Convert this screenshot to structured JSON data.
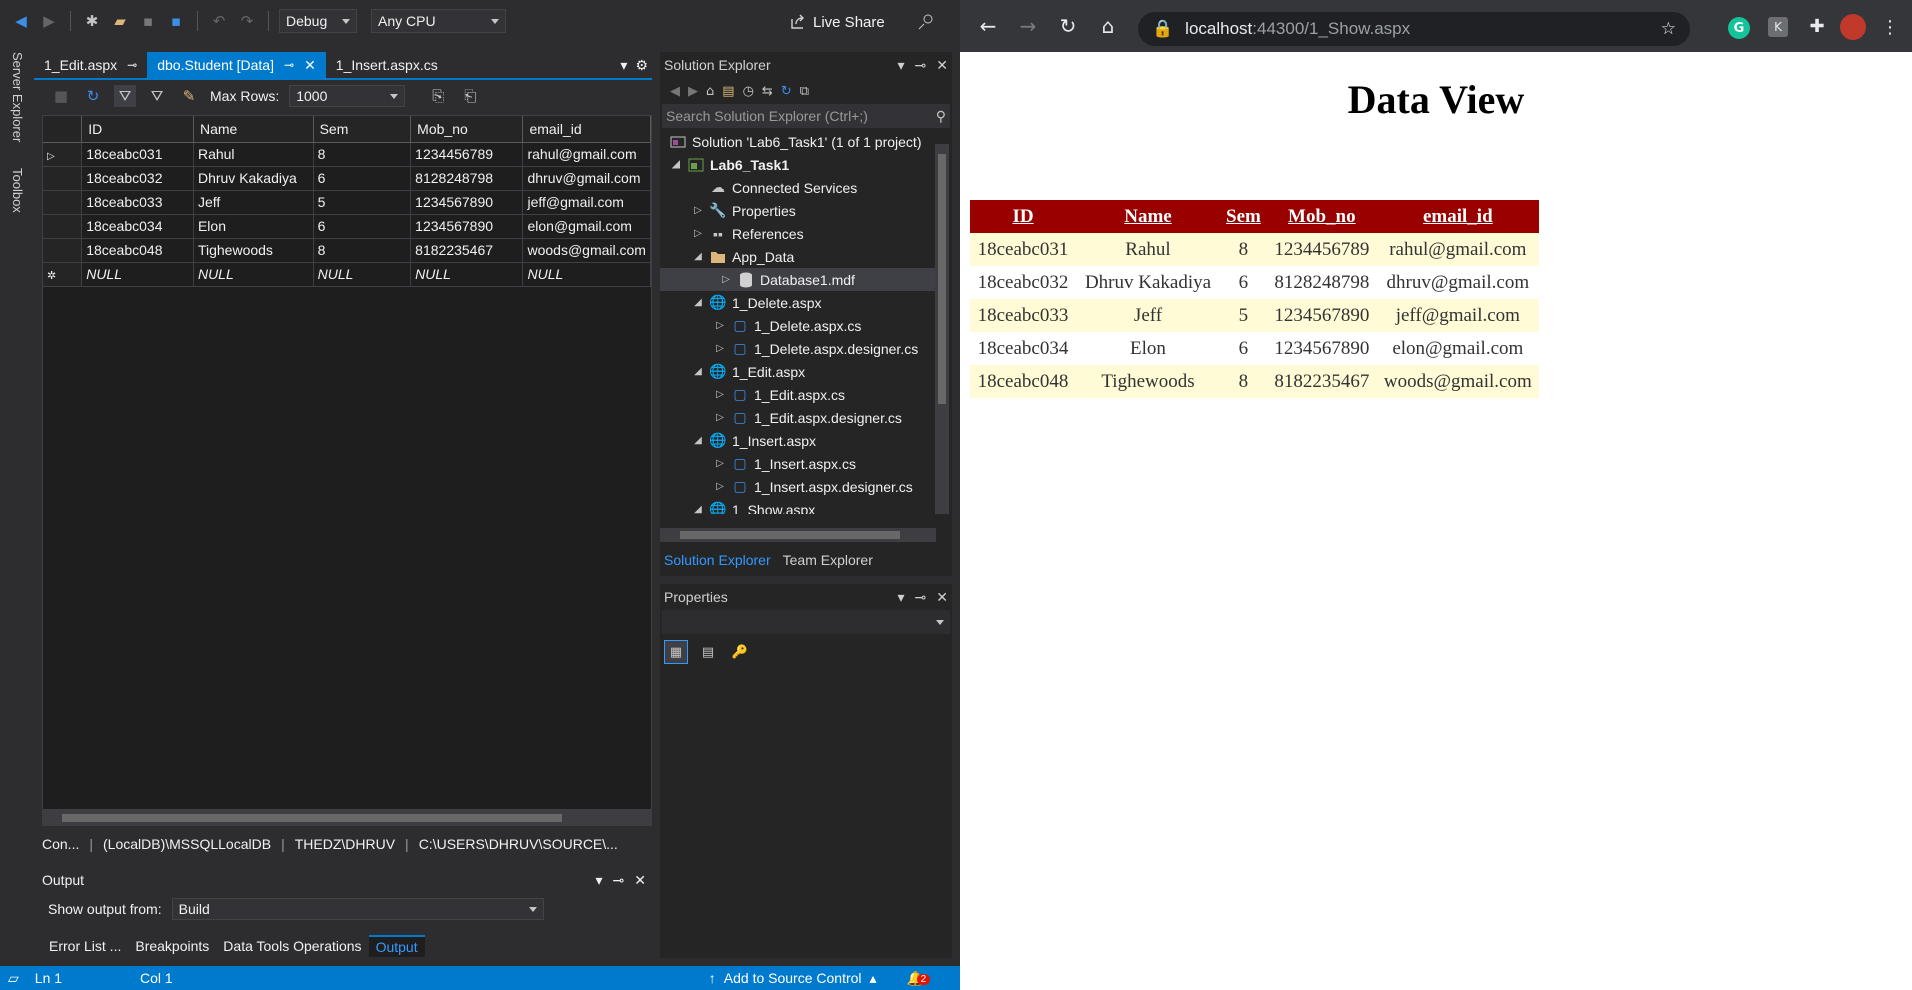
{
  "vs": {
    "toolbar": {
      "config": "Debug",
      "platform": "Any CPU",
      "live_share": "Live Share"
    },
    "side_rail": {
      "server_explorer": "Server Explorer",
      "toolbox": "Toolbox"
    },
    "doc_tabs": [
      "1_Edit.aspx",
      "dbo.Student [Data]",
      "1_Insert.aspx.cs"
    ],
    "data_toolbar": {
      "max_rows_label": "Max Rows:",
      "max_rows_value": "1000"
    },
    "grid": {
      "columns": [
        "ID",
        "Name",
        "Sem",
        "Mob_no",
        "email_id"
      ],
      "rows": [
        [
          "18ceabc031",
          "Rahul",
          "8",
          "1234456789",
          "rahul@gmail.com"
        ],
        [
          "18ceabc032",
          "Dhruv Kakadiya",
          "6",
          "8128248798",
          "dhruv@gmail.com"
        ],
        [
          "18ceabc033",
          "Jeff",
          "5",
          "1234567890",
          "jeff@gmail.com"
        ],
        [
          "18ceabc034",
          "Elon",
          "6",
          "1234567890",
          "elon@gmail.com"
        ],
        [
          "18ceabc048",
          "Tighewoods",
          "8",
          "8182235467",
          "woods@gmail.com"
        ]
      ],
      "null_row": [
        "NULL",
        "NULL",
        "NULL",
        "NULL",
        "NULL"
      ]
    },
    "connection": {
      "label": "Con...",
      "server": "(LocalDB)\\MSSQLLocalDB",
      "user": "THEDZ\\DHRUV",
      "path": "C:\\USERS\\DHRUV\\SOURCE\\..."
    },
    "output": {
      "title": "Output",
      "show_from_label": "Show output from:",
      "show_from_value": "Build"
    },
    "bottom_tabs": [
      "Error List ...",
      "Breakpoints",
      "Data Tools Operations",
      "Output"
    ],
    "status": {
      "line": "Ln 1",
      "col": "Col 1",
      "source_control": "Add to Source Control",
      "notifications": "2"
    },
    "solution_explorer": {
      "title": "Solution Explorer",
      "search_placeholder": "Search Solution Explorer (Ctrl+;)",
      "items": [
        "Solution 'Lab6_Task1' (1 of 1 project)",
        "Lab6_Task1",
        "Connected Services",
        "Properties",
        "References",
        "App_Data",
        "Database1.mdf",
        "1_Delete.aspx",
        "1_Delete.aspx.cs",
        "1_Delete.aspx.designer.cs",
        "1_Edit.aspx",
        "1_Edit.aspx.cs",
        "1_Edit.aspx.designer.cs",
        "1_Insert.aspx",
        "1_Insert.aspx.cs",
        "1_Insert.aspx.designer.cs",
        "1_Show.aspx"
      ],
      "tabs": [
        "Solution Explorer",
        "Team Explorer"
      ]
    },
    "properties": {
      "title": "Properties"
    }
  },
  "browser": {
    "url_host": "localhost",
    "url_path": ":44300/1_Show.aspx",
    "page_title": "Data View",
    "table": {
      "columns": [
        "ID",
        "Name",
        "Sem",
        "Mob_no",
        "email_id"
      ],
      "rows": [
        [
          "18ceabc031",
          "Rahul",
          "8",
          "1234456789",
          "rahul@gmail.com"
        ],
        [
          "18ceabc032",
          "Dhruv Kakadiya",
          "6",
          "8128248798",
          "dhruv@gmail.com"
        ],
        [
          "18ceabc033",
          "Jeff",
          "5",
          "1234567890",
          "jeff@gmail.com"
        ],
        [
          "18ceabc034",
          "Elon",
          "6",
          "1234567890",
          "elon@gmail.com"
        ],
        [
          "18ceabc048",
          "Tighewoods",
          "8",
          "8182235467",
          "woods@gmail.com"
        ]
      ]
    }
  },
  "colors": {
    "vs_accent": "#007acc",
    "header_red": "#990000",
    "row_alt": "#fffbd6"
  }
}
